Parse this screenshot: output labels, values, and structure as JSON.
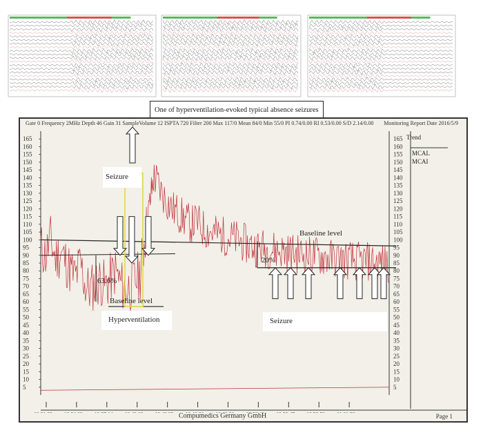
{
  "callout_text": "One of hyperventilation-evoked typical absence seizures",
  "header": {
    "left": "Gate 0 Frequency 2MHz Depth 46 Gain 31 SampleVolume 12 ISPTA 720 Filter 200 Max 117/0 Mean 84/0 Min 55/0 PI 0.74/0.00 RI 0.53/0.00 S/D 2.14/0.00",
    "right": "Monitoring Report Date 2016/5/9"
  },
  "footer": {
    "company": "Compumedics Germany GmbH",
    "page": "Page 1"
  },
  "trend_panel": {
    "title": "Trend",
    "labels": [
      "MCAL",
      "MCAI"
    ]
  },
  "annotations": {
    "seizure_left": "Seizure",
    "seizure_right": "Seizure",
    "hyperventilation": "Hyperventilation",
    "baseline_left": "Baseline level",
    "baseline_right": "Baseline level",
    "drop_left": "63.6%",
    "drop_right": "20%"
  },
  "colors": {
    "trace": "#c0303a",
    "highlight": "#e8d64a",
    "baseline": "#222222",
    "screen": "#f2f0e8"
  },
  "chart_data": {
    "type": "line",
    "y_ticks": [
      5,
      10,
      15,
      20,
      25,
      30,
      35,
      40,
      45,
      50,
      55,
      60,
      65,
      70,
      75,
      80,
      85,
      90,
      95,
      100,
      105,
      110,
      115,
      120,
      125,
      130,
      135,
      140,
      145,
      150,
      155,
      160,
      165
    ],
    "right_ticks": [
      5,
      10,
      15,
      20,
      25,
      30,
      35,
      40,
      45,
      50,
      55,
      60,
      65,
      70,
      75,
      80,
      85,
      90,
      95,
      100,
      105,
      110,
      115,
      120,
      125,
      130,
      135,
      140,
      145,
      150,
      155,
      160,
      165
    ],
    "ylim": [
      0,
      170
    ],
    "x_ticks": [
      "10:31:03",
      "10:34:08",
      "10:37:14",
      "10:40:19",
      "10:43:25",
      "10:46:30",
      "10:49:36",
      "10:52:41",
      "10:55:47",
      "10:58:52",
      "11:01:58"
    ],
    "x_range": [
      "10:31:03",
      "11:06:00"
    ],
    "series": [
      {
        "values": [
          [
            0,
            95
          ],
          [
            6,
            90
          ],
          [
            12,
            100
          ],
          [
            18,
            88
          ],
          [
            24,
            92
          ],
          [
            30,
            86
          ],
          [
            36,
            80
          ],
          [
            42,
            76
          ],
          [
            48,
            85
          ],
          [
            54,
            70
          ],
          [
            60,
            68
          ],
          [
            66,
            72
          ],
          [
            72,
            74
          ],
          [
            78,
            70
          ],
          [
            84,
            75
          ],
          [
            90,
            80
          ],
          [
            96,
            72
          ],
          [
            102,
            68
          ],
          [
            108,
            70
          ],
          [
            114,
            74
          ],
          [
            120,
            78
          ],
          [
            124,
            95
          ],
          [
            128,
            110
          ],
          [
            132,
            125
          ],
          [
            136,
            140
          ],
          [
            140,
            138
          ],
          [
            146,
            130
          ],
          [
            152,
            125
          ],
          [
            158,
            120
          ],
          [
            164,
            118
          ],
          [
            170,
            115
          ],
          [
            176,
            112
          ],
          [
            182,
            110
          ],
          [
            188,
            112
          ],
          [
            194,
            108
          ],
          [
            200,
            106
          ],
          [
            206,
            105
          ],
          [
            212,
            104
          ],
          [
            218,
            103
          ],
          [
            224,
            102
          ],
          [
            230,
            101
          ],
          [
            236,
            100
          ],
          [
            242,
            99
          ],
          [
            248,
            97
          ],
          [
            254,
            96
          ],
          [
            260,
            95
          ],
          [
            266,
            95
          ],
          [
            272,
            94
          ],
          [
            278,
            94
          ],
          [
            284,
            93
          ],
          [
            290,
            93
          ],
          [
            296,
            92
          ],
          [
            302,
            92
          ],
          [
            308,
            91
          ],
          [
            314,
            91
          ],
          [
            320,
            90
          ],
          [
            326,
            90
          ],
          [
            332,
            90
          ],
          [
            338,
            89
          ],
          [
            344,
            89
          ],
          [
            350,
            88
          ],
          [
            356,
            88
          ],
          [
            362,
            87
          ],
          [
            368,
            87
          ],
          [
            374,
            87
          ],
          [
            380,
            86
          ],
          [
            386,
            86
          ],
          [
            392,
            86
          ],
          [
            398,
            86
          ],
          [
            404,
            85
          ],
          [
            410,
            85
          ],
          [
            416,
            85
          ],
          [
            420,
            85
          ]
        ]
      }
    ],
    "baselines": [
      {
        "label": "Baseline level",
        "y": 97
      },
      {
        "label": "Baseline level",
        "y": 60
      }
    ]
  }
}
